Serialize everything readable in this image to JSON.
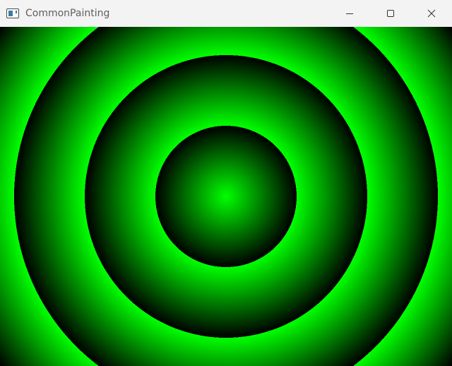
{
  "window": {
    "title": "CommonPainting",
    "icon": "app-window-icon",
    "controls": [
      {
        "name": "minimize-button",
        "icon": "minimize-icon"
      },
      {
        "name": "maximize-button",
        "icon": "maximize-icon"
      },
      {
        "name": "close-button",
        "icon": "close-icon"
      }
    ]
  },
  "canvas": {
    "gradient": "radial-repeat",
    "colors": {
      "inner": "#00ff00",
      "outer": "#000000",
      "background": "#000000"
    }
  }
}
